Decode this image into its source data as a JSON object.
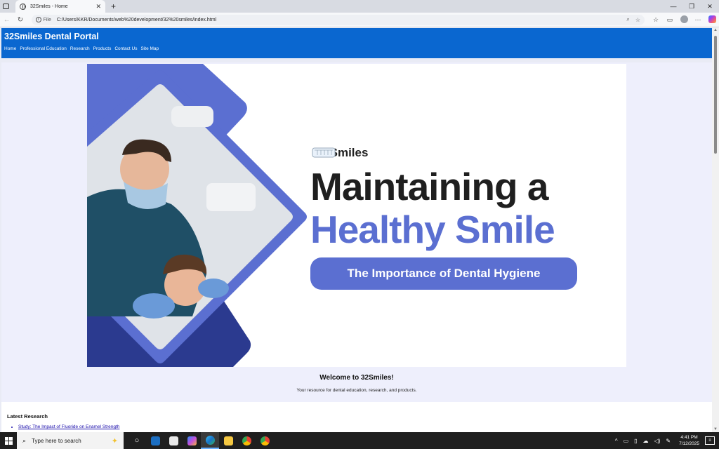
{
  "browser": {
    "tab_title": "32Smiles - Home",
    "address_chip": "File",
    "url": "C:/Users/KKR/Documents/web%20development/32%20smiles/index.html"
  },
  "site": {
    "title": "32Smiles Dental Portal",
    "nav": [
      "Home",
      "Professional Education",
      "Research",
      "Products",
      "Contact Us",
      "Site Map"
    ]
  },
  "hero": {
    "brand": "32 Smiles",
    "headline_line1": "Maintaining a",
    "headline_line2": "Healthy Smile",
    "tagline": "The Importance of Dental Hygiene",
    "colors": {
      "accent": "#5b6fd1",
      "dark_accent": "#2b3a8f",
      "header": "#0a67d0"
    }
  },
  "welcome": {
    "heading": "Welcome to 32Smiles!",
    "text": "Your resource for dental education, research, and products."
  },
  "research": {
    "heading": "Latest Research",
    "items": [
      "Study: The Impact of Fluoride on Enamel Strength"
    ]
  },
  "taskbar": {
    "search_placeholder": "Type here to search",
    "time": "4:41 PM",
    "date": "7/12/2025"
  }
}
